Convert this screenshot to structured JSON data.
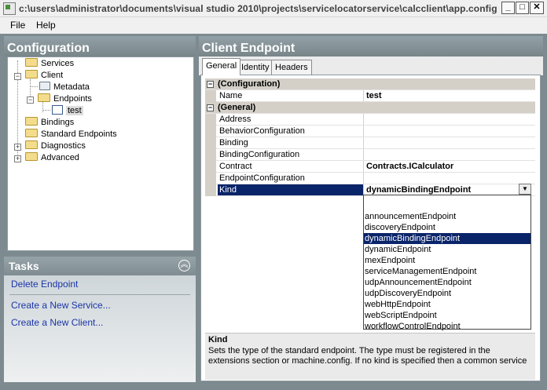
{
  "window": {
    "title": "c:\\users\\administrator\\documents\\visual studio 2010\\projects\\servicelocatorservice\\calcclient\\app.config - Micro...",
    "minimize_label": "_",
    "maximize_label": "□",
    "close_label": "✕"
  },
  "menu": {
    "file": "File",
    "help": "Help"
  },
  "configuration": {
    "title": "Configuration",
    "tree": {
      "services": "Services",
      "client": "Client",
      "metadata": "Metadata",
      "endpoints": "Endpoints",
      "test": "test",
      "bindings": "Bindings",
      "standard_endpoints": "Standard Endpoints",
      "diagnostics": "Diagnostics",
      "advanced": "Advanced"
    }
  },
  "tasks": {
    "title": "Tasks",
    "delete_endpoint": "Delete Endpoint",
    "create_service": "Create a New Service...",
    "create_client": "Create a New Client..."
  },
  "client_endpoint": {
    "title": "Client Endpoint",
    "tabs": {
      "general": "General",
      "identity": "Identity",
      "headers": "Headers"
    }
  },
  "grid": {
    "cat_configuration": "(Configuration)",
    "cat_general": "(General)",
    "name_label": "Name",
    "name_value": "test",
    "address_label": "Address",
    "behavior_label": "BehaviorConfiguration",
    "binding_label": "Binding",
    "binding_config_label": "BindingConfiguration",
    "contract_label": "Contract",
    "contract_value": "Contracts.ICalculator",
    "endpoint_config_label": "EndpointConfiguration",
    "kind_label": "Kind",
    "kind_value": "dynamicBindingEndpoint"
  },
  "dropdown": {
    "options": [
      "",
      "announcementEndpoint",
      "discoveryEndpoint",
      "dynamicBindingEndpoint",
      "dynamicEndpoint",
      "mexEndpoint",
      "serviceManagementEndpoint",
      "udpAnnouncementEndpoint",
      "udpDiscoveryEndpoint",
      "webHttpEndpoint",
      "webScriptEndpoint",
      "workflowControlEndpoint"
    ],
    "selected": "dynamicBindingEndpoint"
  },
  "help": {
    "title": "Kind",
    "description": "Sets the type of the standard endpoint. The type must be registered in the extensions section or machine.config. If no kind is specified then a common service endpoint is cr..."
  },
  "colors": {
    "selection": "#0a246a",
    "link": "#1a35a8",
    "panel": "#7d8a8f"
  }
}
